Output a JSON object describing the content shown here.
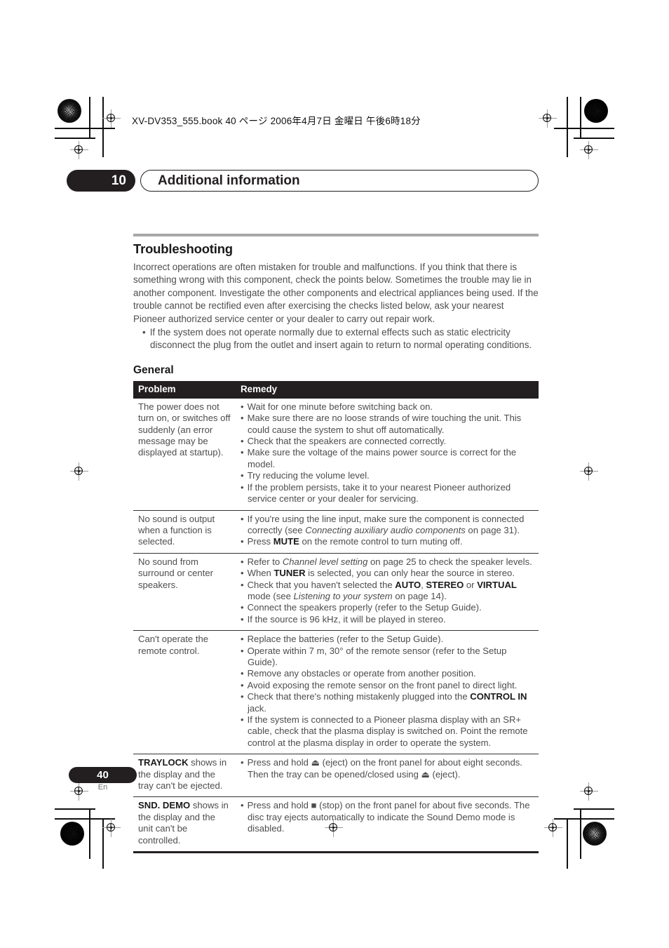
{
  "print_marks": {
    "book_header": "XV-DV353_555.book 40 ページ 2006年4月7日 金曜日 午後6時18分"
  },
  "chapter": {
    "number": "10",
    "title": "Additional information"
  },
  "section": {
    "title": "Troubleshooting",
    "intro": "Incorrect operations are often mistaken for trouble and malfunctions. If you think that there is something wrong with this component, check the points below. Sometimes the trouble may lie in another component. Investigate the other components and electrical appliances being used. If the trouble cannot be rectified even after exercising the checks listed below, ask your nearest Pioneer authorized service center or your dealer to carry out repair work.",
    "bullets": [
      "If the system does not operate normally due to external effects such as static electricity disconnect the plug from the outlet and insert again to return to normal operating conditions."
    ],
    "subsection_title": "General"
  },
  "table": {
    "headers": [
      "Problem",
      "Remedy"
    ],
    "rows": [
      {
        "problem": "The power does not turn on, or switches off suddenly (an error message may be displayed at startup).",
        "remedies": [
          "Wait for one minute before switching back on.",
          "Make sure there are no loose strands of wire touching the unit. This could cause the system to shut off automatically.",
          "Check that the speakers are connected correctly.",
          "Make sure the voltage of the mains power source is correct for the model.",
          "Try reducing the volume level.",
          "If the problem persists, take it to your nearest Pioneer authorized service center or your dealer for servicing."
        ]
      },
      {
        "problem": "No sound is output when a function is selected.",
        "remedies": [
          "If you're using the line input, make sure the component is connected correctly (see Connecting auxiliary audio components on page 31).",
          "Press MUTE on the remote control to turn muting off."
        ]
      },
      {
        "problem": "No sound from surround or center speakers.",
        "remedies": [
          "Refer to Channel level setting on page 25 to check the speaker levels.",
          "When TUNER is selected, you can only hear the source in stereo.",
          "Check that you haven't selected the AUTO, STEREO or VIRTUAL mode  (see Listening to your system on page 14).",
          "Connect the speakers properly (refer to the Setup Guide).",
          "If the source is 96 kHz, it will be played in stereo."
        ]
      },
      {
        "problem": "Can't operate the remote control.",
        "remedies": [
          "Replace the batteries (refer to the Setup Guide).",
          "Operate within 7 m, 30° of the remote sensor (refer to the Setup Guide).",
          "Remove any obstacles or operate from another position.",
          "Avoid exposing the remote sensor on the front panel to direct light.",
          "Check that there's nothing mistakenly plugged into the CONTROL IN jack.",
          "If the system is connected to a Pioneer plasma display with an SR+ cable, check that the plasma display is switched on. Point the remote control at the plasma display in order to operate the system."
        ]
      },
      {
        "problem": "TRAYLOCK shows in the display and the tray can't be ejected.",
        "remedies": [
          "Press and hold ⏏ (eject) on the front panel for about eight seconds. Then the tray can be opened/closed using ⏏ (eject)."
        ]
      },
      {
        "problem": "SND. DEMO shows in the display and the unit can't be controlled.",
        "remedies": [
          "Press and hold ■ (stop) on the front panel for about five seconds. The disc tray ejects automatically to indicate the Sound Demo mode is disabled."
        ]
      }
    ]
  },
  "footer": {
    "page_number": "40",
    "language": "En"
  }
}
